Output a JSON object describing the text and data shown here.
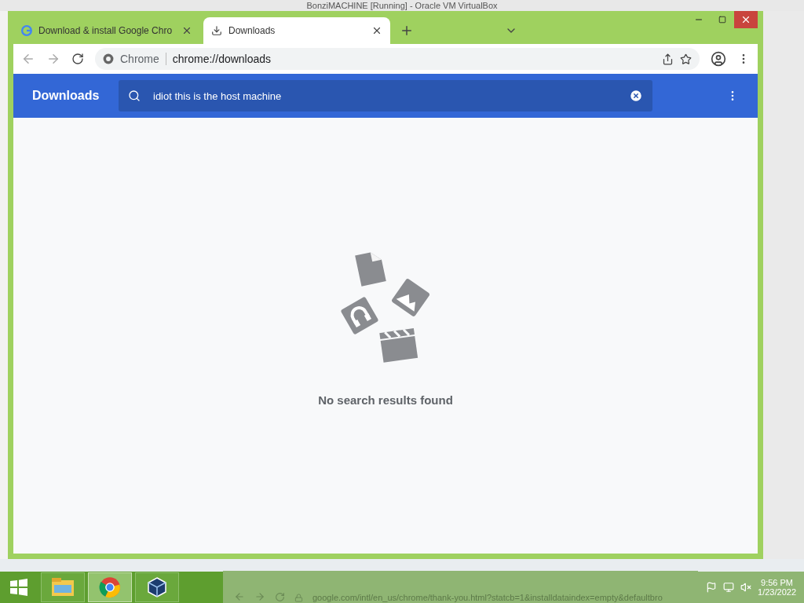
{
  "vm_window": {
    "title": "BonziMACHINE [Running] - Oracle VM VirtualBox"
  },
  "browser": {
    "tabs": [
      {
        "kind": "site",
        "title": "Download & install Google Chro",
        "selected": false
      },
      {
        "kind": "downloads",
        "title": "Downloads",
        "selected": true
      }
    ],
    "address": {
      "site_label": "Chrome",
      "url": "chrome://downloads"
    }
  },
  "page": {
    "title": "Downloads",
    "search": {
      "value": "idiot this is the host machine"
    },
    "empty_message": "No search results found"
  },
  "taskbar": {
    "apps": [
      {
        "kind": "explorer",
        "selected": false
      },
      {
        "kind": "chrome",
        "selected": true
      },
      {
        "kind": "virtualbox",
        "selected": false
      }
    ],
    "background_url": "google.com/intl/en_us/chrome/thank-you.html?statcb=1&installdataindex=empty&defaultbro",
    "clock": {
      "time": "9:56 PM",
      "date": "1/23/2022"
    }
  }
}
